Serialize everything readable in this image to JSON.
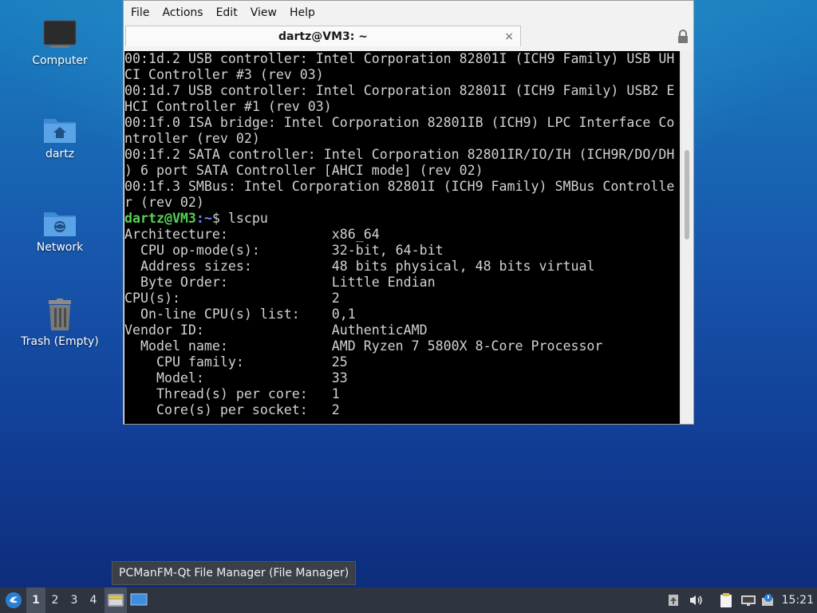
{
  "desktop": {
    "icons": [
      {
        "label": "Computer",
        "icon": "computer-icon"
      },
      {
        "label": "dartz",
        "icon": "home-folder-icon"
      },
      {
        "label": "Network",
        "icon": "network-folder-icon"
      },
      {
        "label": "Trash (Empty)",
        "icon": "trash-icon"
      }
    ]
  },
  "window": {
    "menu": [
      "File",
      "Actions",
      "Edit",
      "View",
      "Help"
    ],
    "tab_title": "dartz@VM3: ~",
    "tab_close": "×",
    "terminal": {
      "lines_before": [
        "00:1d.2 USB controller: Intel Corporation 82801I (ICH9 Family) USB UH",
        "CI Controller #3 (rev 03)",
        "00:1d.7 USB controller: Intel Corporation 82801I (ICH9 Family) USB2 E",
        "HCI Controller #1 (rev 03)",
        "00:1f.0 ISA bridge: Intel Corporation 82801IB (ICH9) LPC Interface Co",
        "ntroller (rev 02)",
        "00:1f.2 SATA controller: Intel Corporation 82801IR/IO/IH (ICH9R/DO/DH",
        ") 6 port SATA Controller [AHCI mode] (rev 02)",
        "00:1f.3 SMBus: Intel Corporation 82801I (ICH9 Family) SMBus Controlle",
        "r (rev 02)"
      ],
      "prompt_user": "dartz@VM3",
      "prompt_path": ":~",
      "prompt_cmd": "$ lscpu",
      "lines_after": [
        "Architecture:             x86_64",
        "  CPU op-mode(s):         32-bit, 64-bit",
        "  Address sizes:          48 bits physical, 48 bits virtual",
        "  Byte Order:             Little Endian",
        "CPU(s):                   2",
        "  On-line CPU(s) list:    0,1",
        "Vendor ID:                AuthenticAMD",
        "  Model name:             AMD Ryzen 7 5800X 8-Core Processor",
        "    CPU family:           25",
        "    Model:                33",
        "    Thread(s) per core:   1",
        "    Core(s) per socket:   2"
      ]
    }
  },
  "tooltip": "PCManFM-Qt File Manager (File Manager)",
  "taskbar": {
    "workspaces": [
      "1",
      "2",
      "3",
      "4"
    ],
    "active_workspace": "1",
    "clock": "15:21"
  }
}
